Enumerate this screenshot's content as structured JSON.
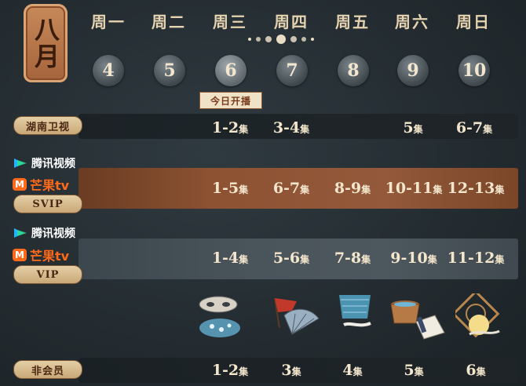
{
  "month": "八月",
  "weekdays": [
    "周一",
    "周二",
    "周三",
    "周四",
    "周五",
    "周六",
    "周日"
  ],
  "dates": [
    "4",
    "5",
    "6",
    "7",
    "8",
    "9",
    "10"
  ],
  "today_label": "今日开播",
  "rows": {
    "hunan": {
      "label": "湖南卫视",
      "episodes": [
        "",
        "",
        "1-2",
        "3-4",
        "",
        "5",
        "6-7"
      ]
    },
    "svip": {
      "platforms": [
        "腾讯视频",
        "芒果tv"
      ],
      "label": "SVIP",
      "episodes": [
        "",
        "",
        "1-5",
        "6-7",
        "8-9",
        "10-11",
        "12-13"
      ]
    },
    "vip": {
      "platforms": [
        "腾讯视频",
        "芒果tv"
      ],
      "label": "VIP",
      "episodes": [
        "",
        "",
        "1-4",
        "5-6",
        "7-8",
        "9-10",
        "11-12"
      ]
    },
    "nonmember": {
      "label": "非会员",
      "episodes": [
        "",
        "",
        "1-2",
        "3",
        "4",
        "5",
        "6"
      ]
    }
  },
  "episode_unit": "集",
  "icons": [
    "mask-icon",
    "flag-fan-icon",
    "hanging-cloth-icon",
    "wooden-tub-icon",
    "moon-window-icon"
  ],
  "colors": {
    "accent": "#a5633b",
    "text": "#f3e6cc",
    "tencent": "#1fb6ff",
    "mango": "#ff6a1a"
  }
}
